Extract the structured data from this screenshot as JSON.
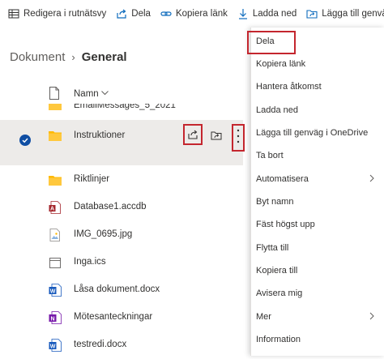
{
  "toolbar": {
    "items": [
      {
        "label": "Redigera i rutnätsvy",
        "icon": "grid-icon"
      },
      {
        "label": "Dela",
        "icon": "share-icon"
      },
      {
        "label": "Kopiera länk",
        "icon": "link-icon"
      },
      {
        "label": "Ladda ned",
        "icon": "download-icon"
      },
      {
        "label": "Lägga till genvä",
        "icon": "add-shortcut-icon"
      }
    ]
  },
  "breadcrumb": {
    "root": "Dokument",
    "separator": "›",
    "current": "General"
  },
  "list": {
    "column_name": "Namn",
    "rows": [
      {
        "name": "EmailMessages_5_2021",
        "type": "folder"
      },
      {
        "name": "Instruktioner",
        "type": "folder",
        "selected": true
      },
      {
        "name": "Riktlinjer",
        "type": "folder"
      },
      {
        "name": "Database1.accdb",
        "type": "access"
      },
      {
        "name": "IMG_0695.jpg",
        "type": "image"
      },
      {
        "name": "Inga.ics",
        "type": "calendar"
      },
      {
        "name": "Låsa dokument.docx",
        "type": "word"
      },
      {
        "name": "Mötesanteckningar",
        "type": "onenote"
      },
      {
        "name": "testredi.docx",
        "type": "word"
      }
    ]
  },
  "menu": {
    "items": [
      {
        "label": "Dela",
        "submenu": false
      },
      {
        "label": "Kopiera länk",
        "submenu": false
      },
      {
        "label": "Hantera åtkomst",
        "submenu": false
      },
      {
        "label": "Ladda ned",
        "submenu": false
      },
      {
        "label": "Lägga till genväg i OneDrive",
        "submenu": false
      },
      {
        "label": "Ta bort",
        "submenu": false
      },
      {
        "label": "Automatisera",
        "submenu": true
      },
      {
        "label": "Byt namn",
        "submenu": false
      },
      {
        "label": "Fäst högst upp",
        "submenu": false
      },
      {
        "label": "Flytta till",
        "submenu": false
      },
      {
        "label": "Kopiera till",
        "submenu": false
      },
      {
        "label": "Avisera mig",
        "submenu": false
      },
      {
        "label": "Mer",
        "submenu": true
      },
      {
        "label": "Information",
        "submenu": false
      }
    ]
  },
  "colors": {
    "highlight": "#c4262e",
    "folder": "#ffb900",
    "check": "#0f4ea3",
    "selected_row": "#edebe9"
  }
}
